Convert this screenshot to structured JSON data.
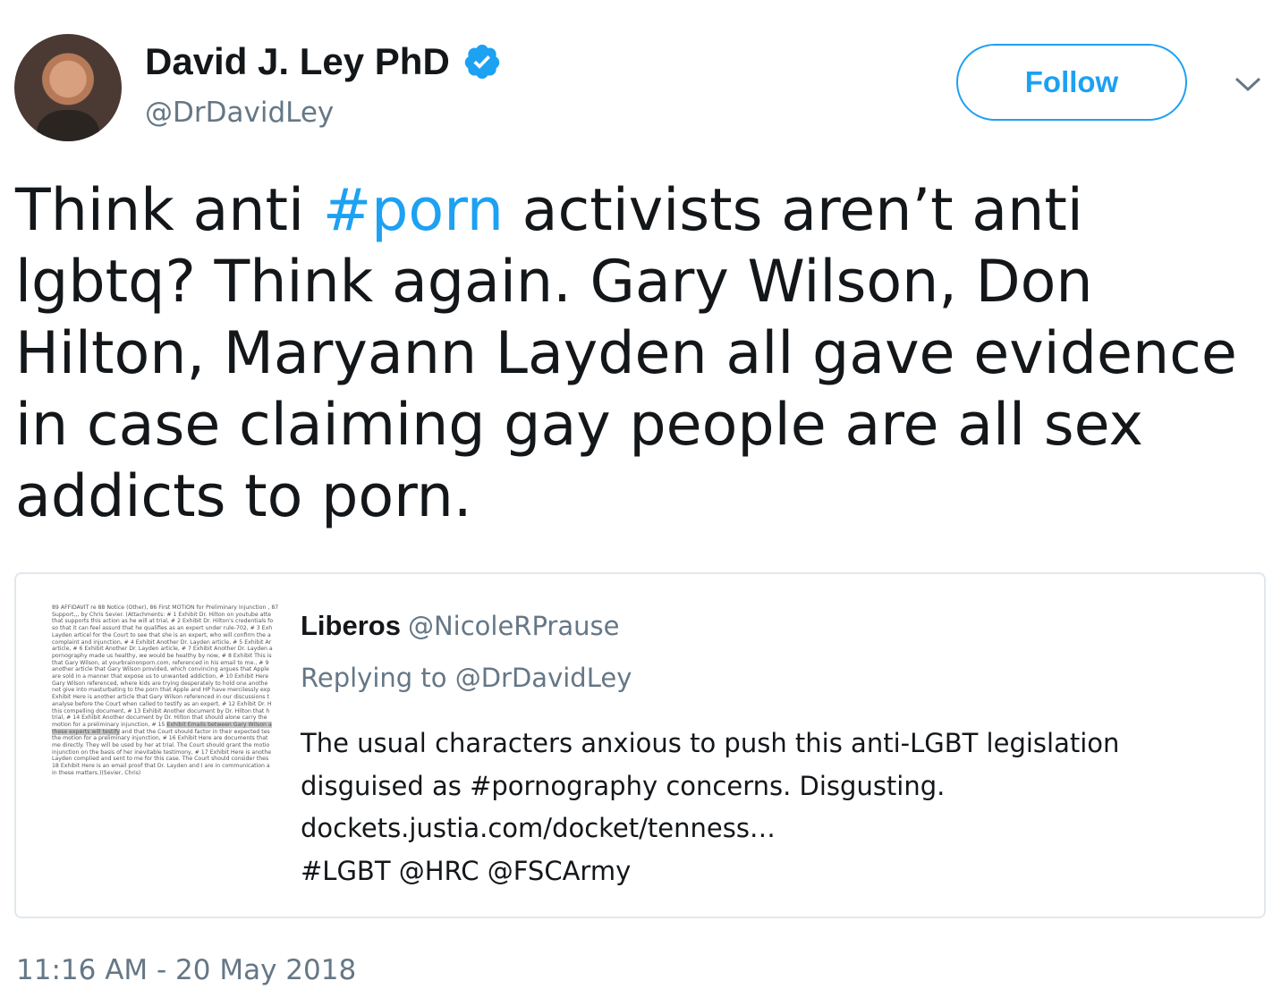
{
  "author": {
    "display_name": "David J. Ley PhD",
    "handle": "@DrDavidLey",
    "verified_icon": "verified-badge-icon",
    "avatar_icon": "avatar"
  },
  "follow_button": {
    "label": "Follow"
  },
  "menu": {
    "icon": "chevron-down-icon"
  },
  "tweet": {
    "text_before": "Think anti ",
    "hashtag": "#porn",
    "text_after": " activists aren’t anti lgbtq? Think again. Gary Wilson, Don Hilton, Maryann Layden all gave evidence in case claiming gay people are all sex addicts to porn."
  },
  "quote": {
    "name": "Liberos",
    "handle": "@NicoleRPrause",
    "reply_prefix": "Replying to ",
    "reply_to": "@DrDavidLey",
    "lines": [
      "The usual characters anxious to push this anti-LGBT legislation",
      "disguised as #pornography concerns. Disgusting.",
      "dockets.justia.com/docket/tenness…",
      "#LGBT @HRC @FSCArmy"
    ],
    "thumbnail_lines": [
      "89 AFFIDAVIT re 88 Notice (Other), 86 First MOTION for Preliminary Injunction , 87",
      "    Support,,, by Chris Sevier. (Attachments: # 1 Exhibit Dr. Hilton on youtube atte",
      "    that supports this action as he will at trial, # 2 Exhibit Dr. Hilton's credentials fo",
      "    so that it can feel assurd that he qualifies as an expert under rule-702, # 3 Exh",
      "    Layden articel for the Court to see that she is an expert, who will confirm the a",
      "    complaint and injunction, # 4 Exhibit Another Dr. Layden article, # 5 Exhibit Ar",
      "    article, # 6 Exhibit Another Dr. Layden article, # 7 Exhibit Another Dr. Layden a",
      "    pornography made us healthy, we would be healthy by now, # 8 Exhibit This is",
      "    that Gary Wilson, at yourbrainonporn.com, referenced in his email to me., # 9",
      "    another article that Gary Wilson provided, which convincing argues that Apple",
      "    are sold in a manner that expose us to unwanted addiction, # 10 Exhibit Here",
      "    Gary Wilson referenced, where kids are trying desperately to hold one anothe",
      "    not give into masturbating to the porn that Apple and HP have mercilessly exp",
      "    Exhibit Here is another article that Gary Wilson referenced in our discussions t",
      "    analyse before the Court when called to testify as an expert, # 12 Exhibit Dr. H",
      "    this compelling document, # 13 Exhibit Another document by Dr. Hilton that h",
      "    trial, # 14 Exhibit Another document by Dr. Hilton that should alone carry the",
      "    motion for a preliminary injunction, # 15 Exhibit Emails between Gary Wilson a",
      "    these experts will testify and that the Court should factor in their expected tes",
      "    the motion for a preliminary injunction, # 16 Exhibit Here are documents that",
      "    me directly. They will be used by her at trial. The Court should grant the motio",
      "    injunction on the basis of her inevitable testimony, # 17 Exhibit Here is anothe",
      "    Layden complied and sent to me for this case. The Court should consider thes",
      "    18 Exhibit Here is an email proof that Dr. Layden and I are in communication a",
      "    in these matters.)(Sevier, Chris)"
    ]
  },
  "timestamp": "11:16 AM - 20 May 2018",
  "colors": {
    "accent": "#1da1f2",
    "text": "#14171a",
    "muted": "#657786",
    "border": "#e1e8ed"
  }
}
